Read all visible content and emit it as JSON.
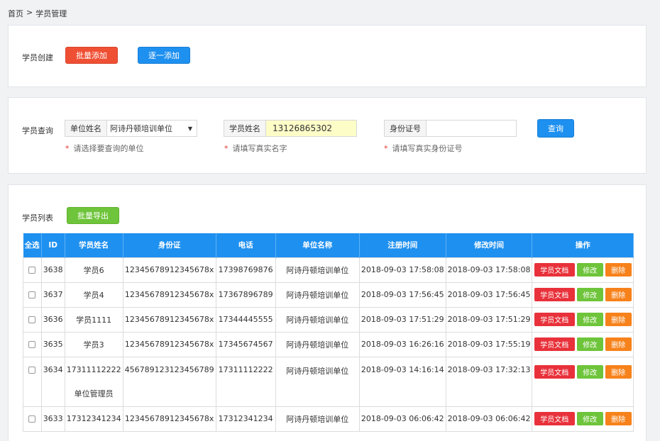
{
  "breadcrumb": {
    "home": "首页",
    "sep": ">",
    "current": "学员管理"
  },
  "create": {
    "label": "学员创建",
    "batch_add": "批量添加",
    "single_add": "逐一添加"
  },
  "query": {
    "label": "学员查询",
    "unit_label": "单位姓名",
    "unit_value": "阿诗丹顿培训单位",
    "unit_hint": "请选择要查询的单位",
    "name_label": "学员姓名",
    "name_value": "13126865302",
    "name_hint": "请填写真实名字",
    "id_label": "身份证号",
    "id_value": "",
    "id_hint": "请填写真实身份证号",
    "search": "查询"
  },
  "list": {
    "label": "学员列表",
    "export": "批量导出",
    "headers": [
      "全选",
      "ID",
      "学员姓名",
      "身份证",
      "电话",
      "单位名称",
      "注册时间",
      "修改时间",
      "操作"
    ],
    "actions": {
      "doc": "学员文档",
      "edit": "修改",
      "del": "删除"
    },
    "rows": [
      {
        "id": "3638",
        "name": "学员6",
        "name2": "",
        "idcard": "12345678912345678x",
        "phone": "17398769876",
        "unit": "阿诗丹顿培训单位",
        "reg": "2018-09-03 17:58:08",
        "mod": "2018-09-03 17:58:08"
      },
      {
        "id": "3637",
        "name": "学员4",
        "name2": "",
        "idcard": "12345678912345678x",
        "phone": "17367896789",
        "unit": "阿诗丹顿培训单位",
        "reg": "2018-09-03 17:56:45",
        "mod": "2018-09-03 17:56:45"
      },
      {
        "id": "3636",
        "name": "学员1111",
        "name2": "",
        "idcard": "12345678912345678x",
        "phone": "17344445555",
        "unit": "阿诗丹顿培训单位",
        "reg": "2018-09-03 17:51:29",
        "mod": "2018-09-03 17:51:29"
      },
      {
        "id": "3635",
        "name": "学员3",
        "name2": "",
        "idcard": "12345678912345678x",
        "phone": "17345674567",
        "unit": "阿诗丹顿培训单位",
        "reg": "2018-09-03 16:26:16",
        "mod": "2018-09-03 17:55:19"
      },
      {
        "id": "3634",
        "name": "17311112222",
        "name2": "单位管理员",
        "idcard": "456789123123456789",
        "phone": "17311112222",
        "unit": "阿诗丹顿培训单位",
        "reg": "2018-09-03 14:16:14",
        "mod": "2018-09-03 17:32:13"
      },
      {
        "id": "3633",
        "name": "17312341234",
        "name2": "",
        "idcard": "12345678912345678x",
        "phone": "17312341234",
        "unit": "阿诗丹顿培训单位",
        "reg": "2018-09-03 06:06:42",
        "mod": "2018-09-03 06:06:42"
      }
    ]
  }
}
